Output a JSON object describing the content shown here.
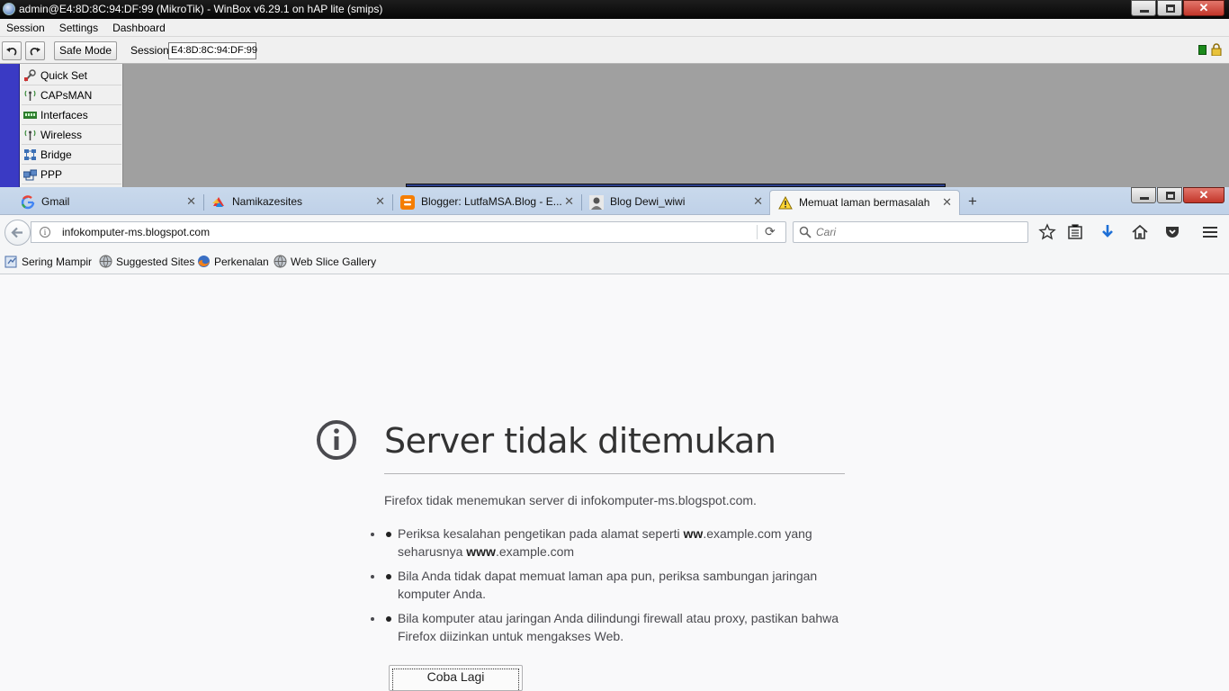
{
  "winbox": {
    "title": "admin@E4:8D:8C:94:DF:99 (MikroTik) - WinBox v6.29.1 on hAP lite (smips)",
    "menu": [
      "Session",
      "Settings",
      "Dashboard"
    ],
    "toolbar": {
      "undo_icon": "undo-icon",
      "redo_icon": "redo-icon",
      "safe_mode_label": "Safe Mode",
      "session_label": "Session:",
      "session_value": "E4:8D:8C:94:DF:99"
    },
    "sidebar": {
      "items": [
        {
          "label": "Quick Set",
          "icon": "quick-set-icon"
        },
        {
          "label": "CAPsMAN",
          "icon": "antenna-icon"
        },
        {
          "label": "Interfaces",
          "icon": "interfaces-icon"
        },
        {
          "label": "Wireless",
          "icon": "wireless-icon"
        },
        {
          "label": "Bridge",
          "icon": "bridge-icon"
        },
        {
          "label": "PPP",
          "icon": "ppp-icon"
        }
      ]
    },
    "status_color": "#1b8a1b",
    "sidebar_bar_color": "#3a3ac4"
  },
  "firefox": {
    "tabs": [
      {
        "label": "Gmail",
        "icon": "google-icon",
        "active": false
      },
      {
        "label": "Namikazesites",
        "icon": "namikaze-icon",
        "active": false
      },
      {
        "label": "Blogger: LutfaMSA.Blog - E...",
        "icon": "blogger-icon",
        "active": false
      },
      {
        "label": "Blog Dewi_wiwi",
        "icon": "blog-avatar-icon",
        "active": false
      },
      {
        "label": "Memuat laman bermasalah",
        "icon": "warning-icon",
        "active": true
      }
    ],
    "new_tab_label": "+",
    "url": "infokomputer-ms.blogspot.com",
    "search_placeholder": "Cari",
    "bookmarks": [
      {
        "label": "Sering Mampir",
        "icon": "bookmark-folder-icon"
      },
      {
        "label": "Suggested Sites",
        "icon": "globe-icon"
      },
      {
        "label": "Perkenalan",
        "icon": "firefox-icon"
      },
      {
        "label": "Web Slice Gallery",
        "icon": "globe-icon"
      }
    ],
    "error": {
      "title": "Server tidak ditemukan",
      "description": "Firefox tidak menemukan server di infokomputer-ms.blogspot.com.",
      "items": [
        {
          "before": "Periksa kesalahan pengetikan pada alamat seperti ",
          "bold1": "ww",
          "middle": ".example.com yang seharusnya ",
          "bold2": "www",
          "after": ".example.com"
        },
        {
          "text": "Bila Anda tidak dapat memuat laman apa pun, periksa sambungan jaringan komputer Anda."
        },
        {
          "text": "Bila komputer atau jaringan Anda dilindungi firewall atau proxy, pastikan bahwa Firefox diizinkan untuk mengakses Web."
        }
      ],
      "retry_label": "Coba Lagi"
    }
  }
}
